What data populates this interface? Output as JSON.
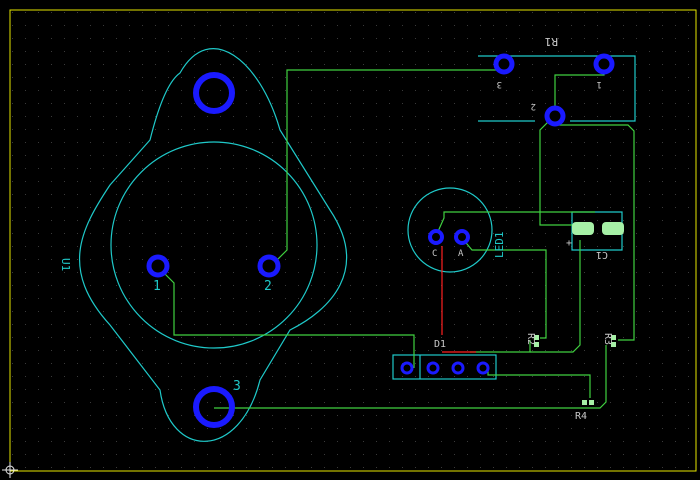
{
  "colors": {
    "background": "#000000",
    "grid_dot": "#3a3a3a",
    "board_outline": "#e6e600",
    "silkscreen": "#1fc9c9",
    "copper_track": "#40d040",
    "jumper_track": "#ff2020",
    "pad_ring": "#1a1aff",
    "pad_hole": "#000000",
    "smd_pad": "#a6f0a6",
    "label": "#1fc9c9",
    "pin_label": "#c8c8c8"
  },
  "components": {
    "u1": {
      "ref": "U1",
      "pin1": "1",
      "pin2": "2",
      "pin3": "3"
    },
    "r1": {
      "ref": "R1",
      "pin1": "1",
      "pin2": "2",
      "pin3": "3"
    },
    "led1": {
      "ref": "LED1",
      "pin_c": "C",
      "pin_a": "A"
    },
    "c1": {
      "ref": "C1",
      "polarity": "+"
    },
    "d1": {
      "ref": "D1"
    },
    "r2": {
      "ref": "R2"
    },
    "r3": {
      "ref": "R3"
    },
    "r4": {
      "ref": "R4"
    }
  },
  "icons": {
    "origin": "crosshair-icon"
  }
}
